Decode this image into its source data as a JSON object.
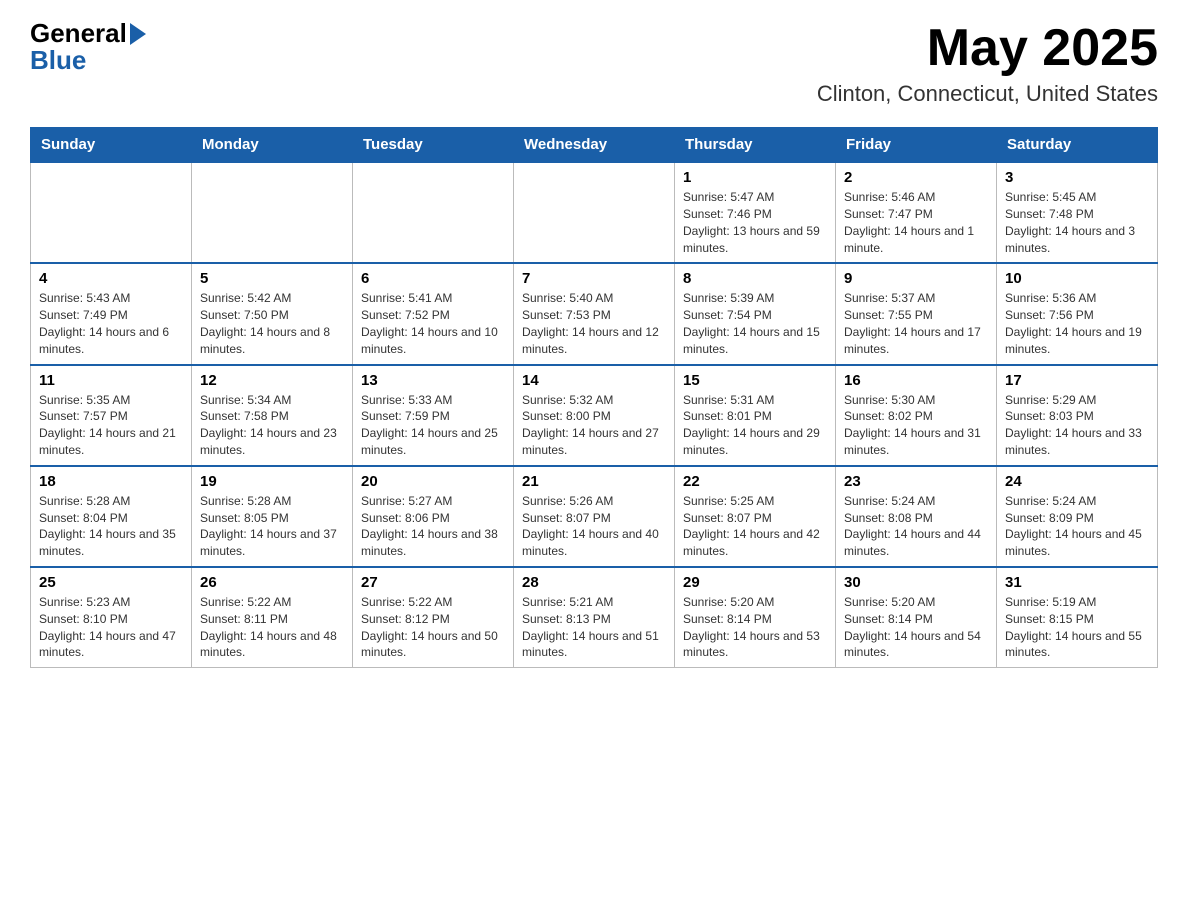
{
  "header": {
    "logo_general": "General",
    "logo_blue": "Blue",
    "month_title": "May 2025",
    "location": "Clinton, Connecticut, United States"
  },
  "days_of_week": [
    "Sunday",
    "Monday",
    "Tuesday",
    "Wednesday",
    "Thursday",
    "Friday",
    "Saturday"
  ],
  "weeks": [
    [
      {
        "day": "",
        "sunrise": "",
        "sunset": "",
        "daylight": ""
      },
      {
        "day": "",
        "sunrise": "",
        "sunset": "",
        "daylight": ""
      },
      {
        "day": "",
        "sunrise": "",
        "sunset": "",
        "daylight": ""
      },
      {
        "day": "",
        "sunrise": "",
        "sunset": "",
        "daylight": ""
      },
      {
        "day": "1",
        "sunrise": "Sunrise: 5:47 AM",
        "sunset": "Sunset: 7:46 PM",
        "daylight": "Daylight: 13 hours and 59 minutes."
      },
      {
        "day": "2",
        "sunrise": "Sunrise: 5:46 AM",
        "sunset": "Sunset: 7:47 PM",
        "daylight": "Daylight: 14 hours and 1 minute."
      },
      {
        "day": "3",
        "sunrise": "Sunrise: 5:45 AM",
        "sunset": "Sunset: 7:48 PM",
        "daylight": "Daylight: 14 hours and 3 minutes."
      }
    ],
    [
      {
        "day": "4",
        "sunrise": "Sunrise: 5:43 AM",
        "sunset": "Sunset: 7:49 PM",
        "daylight": "Daylight: 14 hours and 6 minutes."
      },
      {
        "day": "5",
        "sunrise": "Sunrise: 5:42 AM",
        "sunset": "Sunset: 7:50 PM",
        "daylight": "Daylight: 14 hours and 8 minutes."
      },
      {
        "day": "6",
        "sunrise": "Sunrise: 5:41 AM",
        "sunset": "Sunset: 7:52 PM",
        "daylight": "Daylight: 14 hours and 10 minutes."
      },
      {
        "day": "7",
        "sunrise": "Sunrise: 5:40 AM",
        "sunset": "Sunset: 7:53 PM",
        "daylight": "Daylight: 14 hours and 12 minutes."
      },
      {
        "day": "8",
        "sunrise": "Sunrise: 5:39 AM",
        "sunset": "Sunset: 7:54 PM",
        "daylight": "Daylight: 14 hours and 15 minutes."
      },
      {
        "day": "9",
        "sunrise": "Sunrise: 5:37 AM",
        "sunset": "Sunset: 7:55 PM",
        "daylight": "Daylight: 14 hours and 17 minutes."
      },
      {
        "day": "10",
        "sunrise": "Sunrise: 5:36 AM",
        "sunset": "Sunset: 7:56 PM",
        "daylight": "Daylight: 14 hours and 19 minutes."
      }
    ],
    [
      {
        "day": "11",
        "sunrise": "Sunrise: 5:35 AM",
        "sunset": "Sunset: 7:57 PM",
        "daylight": "Daylight: 14 hours and 21 minutes."
      },
      {
        "day": "12",
        "sunrise": "Sunrise: 5:34 AM",
        "sunset": "Sunset: 7:58 PM",
        "daylight": "Daylight: 14 hours and 23 minutes."
      },
      {
        "day": "13",
        "sunrise": "Sunrise: 5:33 AM",
        "sunset": "Sunset: 7:59 PM",
        "daylight": "Daylight: 14 hours and 25 minutes."
      },
      {
        "day": "14",
        "sunrise": "Sunrise: 5:32 AM",
        "sunset": "Sunset: 8:00 PM",
        "daylight": "Daylight: 14 hours and 27 minutes."
      },
      {
        "day": "15",
        "sunrise": "Sunrise: 5:31 AM",
        "sunset": "Sunset: 8:01 PM",
        "daylight": "Daylight: 14 hours and 29 minutes."
      },
      {
        "day": "16",
        "sunrise": "Sunrise: 5:30 AM",
        "sunset": "Sunset: 8:02 PM",
        "daylight": "Daylight: 14 hours and 31 minutes."
      },
      {
        "day": "17",
        "sunrise": "Sunrise: 5:29 AM",
        "sunset": "Sunset: 8:03 PM",
        "daylight": "Daylight: 14 hours and 33 minutes."
      }
    ],
    [
      {
        "day": "18",
        "sunrise": "Sunrise: 5:28 AM",
        "sunset": "Sunset: 8:04 PM",
        "daylight": "Daylight: 14 hours and 35 minutes."
      },
      {
        "day": "19",
        "sunrise": "Sunrise: 5:28 AM",
        "sunset": "Sunset: 8:05 PM",
        "daylight": "Daylight: 14 hours and 37 minutes."
      },
      {
        "day": "20",
        "sunrise": "Sunrise: 5:27 AM",
        "sunset": "Sunset: 8:06 PM",
        "daylight": "Daylight: 14 hours and 38 minutes."
      },
      {
        "day": "21",
        "sunrise": "Sunrise: 5:26 AM",
        "sunset": "Sunset: 8:07 PM",
        "daylight": "Daylight: 14 hours and 40 minutes."
      },
      {
        "day": "22",
        "sunrise": "Sunrise: 5:25 AM",
        "sunset": "Sunset: 8:07 PM",
        "daylight": "Daylight: 14 hours and 42 minutes."
      },
      {
        "day": "23",
        "sunrise": "Sunrise: 5:24 AM",
        "sunset": "Sunset: 8:08 PM",
        "daylight": "Daylight: 14 hours and 44 minutes."
      },
      {
        "day": "24",
        "sunrise": "Sunrise: 5:24 AM",
        "sunset": "Sunset: 8:09 PM",
        "daylight": "Daylight: 14 hours and 45 minutes."
      }
    ],
    [
      {
        "day": "25",
        "sunrise": "Sunrise: 5:23 AM",
        "sunset": "Sunset: 8:10 PM",
        "daylight": "Daylight: 14 hours and 47 minutes."
      },
      {
        "day": "26",
        "sunrise": "Sunrise: 5:22 AM",
        "sunset": "Sunset: 8:11 PM",
        "daylight": "Daylight: 14 hours and 48 minutes."
      },
      {
        "day": "27",
        "sunrise": "Sunrise: 5:22 AM",
        "sunset": "Sunset: 8:12 PM",
        "daylight": "Daylight: 14 hours and 50 minutes."
      },
      {
        "day": "28",
        "sunrise": "Sunrise: 5:21 AM",
        "sunset": "Sunset: 8:13 PM",
        "daylight": "Daylight: 14 hours and 51 minutes."
      },
      {
        "day": "29",
        "sunrise": "Sunrise: 5:20 AM",
        "sunset": "Sunset: 8:14 PM",
        "daylight": "Daylight: 14 hours and 53 minutes."
      },
      {
        "day": "30",
        "sunrise": "Sunrise: 5:20 AM",
        "sunset": "Sunset: 8:14 PM",
        "daylight": "Daylight: 14 hours and 54 minutes."
      },
      {
        "day": "31",
        "sunrise": "Sunrise: 5:19 AM",
        "sunset": "Sunset: 8:15 PM",
        "daylight": "Daylight: 14 hours and 55 minutes."
      }
    ]
  ]
}
